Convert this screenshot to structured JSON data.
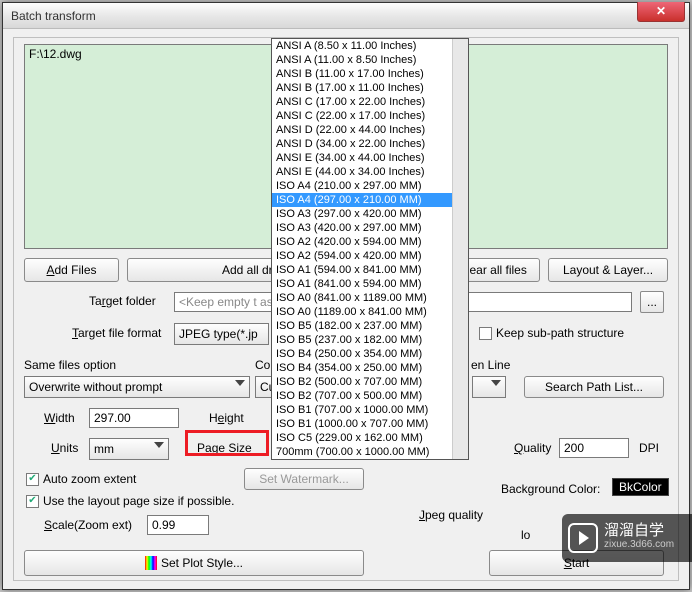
{
  "window": {
    "title": "Batch transform"
  },
  "filelist": {
    "items": [
      "F:\\12.dwg"
    ]
  },
  "buttons": {
    "add_files": "Add Files",
    "add_all": "Add all drawing files of",
    "clear": "Clear all files",
    "layout_layer": "Layout & Layer...",
    "set_watermark": "Set Watermark...",
    "search_path": "Search Path List...",
    "set_plot_style": "Set Plot Style...",
    "start": "Start",
    "ellipsis": "..."
  },
  "labels": {
    "target_folder": "Target folder",
    "target_folder_placeholder": "<Keep empty t                                              as the original drawing>",
    "target_file_format": "Target file format",
    "target_file_format_value": "JPEG type(*.jp",
    "keep_subpath": "Keep sub-path structure",
    "same_files": "Same files option",
    "same_files_value": "Overwrite without prompt",
    "cor": "Cor",
    "cur": "Cur",
    "en_line": "en Line",
    "width": "Width",
    "width_value": "297.00",
    "height": "Height",
    "units": "Units",
    "units_value": "mm",
    "page_size": "Page Size",
    "page_size_value": "ISO A4 (297.00 x 210.00 MM)",
    "quality": "Quality",
    "quality_value": "200",
    "dpi": "DPI",
    "auto_zoom": "Auto zoom extent",
    "layout_size": "Use the layout page size if possible.",
    "scale": "Scale(Zoom ext)",
    "scale_value": "0.99",
    "bg_color": "Background Color:",
    "bkcolor": "BkColor",
    "jpeg_quality": "Jpeg quality",
    "low": "lo"
  },
  "page_sizes": [
    "ANSI A (8.50 x 11.00 Inches)",
    "ANSI A (11.00 x 8.50 Inches)",
    "ANSI B (11.00 x 17.00 Inches)",
    "ANSI B (17.00 x 11.00 Inches)",
    "ANSI C (17.00 x 22.00 Inches)",
    "ANSI C (22.00 x 17.00 Inches)",
    "ANSI D (22.00 x 44.00 Inches)",
    "ANSI D (34.00 x 22.00 Inches)",
    "ANSI E (34.00 x 44.00 Inches)",
    "ANSI E (44.00 x 34.00 Inches)",
    "ISO A4 (210.00 x 297.00 MM)",
    "ISO A4 (297.00 x 210.00 MM)",
    "ISO A3 (297.00 x 420.00 MM)",
    "ISO A3 (420.00 x 297.00 MM)",
    "ISO A2 (420.00 x 594.00 MM)",
    "ISO A2 (594.00 x 420.00 MM)",
    "ISO A1 (594.00 x 841.00 MM)",
    "ISO A1 (841.00 x 594.00 MM)",
    "ISO A0 (841.00 x 1189.00 MM)",
    "ISO A0 (1189.00 x 841.00 MM)",
    "ISO B5 (182.00 x 237.00 MM)",
    "ISO B5 (237.00 x 182.00 MM)",
    "ISO B4 (250.00 x 354.00 MM)",
    "ISO B4 (354.00 x 250.00 MM)",
    "ISO B2 (500.00 x 707.00 MM)",
    "ISO B2 (707.00 x 500.00 MM)",
    "ISO B1 (707.00 x 1000.00 MM)",
    "ISO B1 (1000.00 x 707.00 MM)",
    "ISO C5 (229.00 x 162.00 MM)",
    "700mm (700.00 x 1000.00 MM)"
  ],
  "page_size_selected_index": 11,
  "watermark": {
    "brand": "溜溜自学",
    "domain": "zixue.3d66.com"
  }
}
